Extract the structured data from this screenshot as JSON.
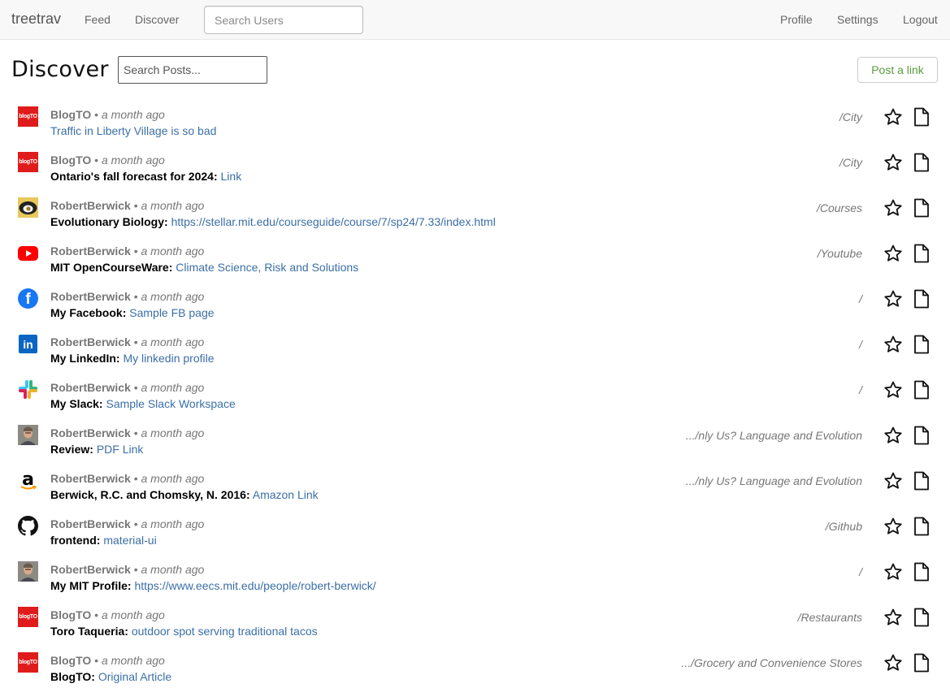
{
  "navbar": {
    "brand": "treetrav",
    "links": {
      "feed": "Feed",
      "discover": "Discover"
    },
    "search_placeholder": "Search Users",
    "right": {
      "profile": "Profile",
      "settings": "Settings",
      "logout": "Logout"
    }
  },
  "page": {
    "title": "Discover",
    "search_placeholder": "Search Posts...",
    "post_button": "Post a link"
  },
  "posts": [
    {
      "icon": "blogto-icon",
      "author": "BlogTO",
      "time": "a month ago",
      "label": "",
      "link": "Traffic in Liberty Village is so bad",
      "path": "/City"
    },
    {
      "icon": "blogto-icon",
      "author": "BlogTO",
      "time": "a month ago",
      "label": "Ontario's fall forecast for 2024:",
      "link": "Link",
      "path": "/City"
    },
    {
      "icon": "mit-courses-icon",
      "author": "RobertBerwick",
      "time": "a month ago",
      "label": "Evolutionary Biology:",
      "link": "https://stellar.mit.edu/courseguide/course/7/sp24/7.33/index.html",
      "path": "/Courses"
    },
    {
      "icon": "youtube-icon",
      "author": "RobertBerwick",
      "time": "a month ago",
      "label": "MIT OpenCourseWare:",
      "link": "Climate Science, Risk and Solutions",
      "path": "/Youtube"
    },
    {
      "icon": "facebook-icon",
      "author": "RobertBerwick",
      "time": "a month ago",
      "label": "My Facebook:",
      "link": "Sample FB page",
      "path": "/"
    },
    {
      "icon": "linkedin-icon",
      "author": "RobertBerwick",
      "time": "a month ago",
      "label": "My LinkedIn:",
      "link": "My linkedin profile",
      "path": "/"
    },
    {
      "icon": "slack-icon",
      "author": "RobertBerwick",
      "time": "a month ago",
      "label": "My Slack:",
      "link": "Sample Slack Workspace",
      "path": "/"
    },
    {
      "icon": "person-photo-icon",
      "author": "RobertBerwick",
      "time": "a month ago",
      "label": "Review:",
      "link": "PDF Link",
      "path": ".../nly Us? Language and Evolution"
    },
    {
      "icon": "amazon-icon",
      "author": "RobertBerwick",
      "time": "a month ago",
      "label": "Berwick, R.C. and Chomsky, N. 2016:",
      "link": "Amazon Link",
      "path": ".../nly Us? Language and Evolution"
    },
    {
      "icon": "github-icon",
      "author": "RobertBerwick",
      "time": "a month ago",
      "label": "frontend:",
      "link": "material-ui",
      "path": "/Github"
    },
    {
      "icon": "person-photo-icon",
      "author": "RobertBerwick",
      "time": "a month ago",
      "label": "My MIT Profile:",
      "link": "https://www.eecs.mit.edu/people/robert-berwick/",
      "path": "/"
    },
    {
      "icon": "blogto-icon",
      "author": "BlogTO",
      "time": "a month ago",
      "label": "Toro Taqueria:",
      "link": "outdoor spot serving traditional tacos",
      "path": "/Restaurants"
    },
    {
      "icon": "blogto-icon",
      "author": "BlogTO",
      "time": "a month ago",
      "label": "BlogTO:",
      "link": "Original Article",
      "path": ".../Grocery and Convenience Stores"
    }
  ],
  "icon_text": {
    "blogto": "blogTO",
    "facebook": "f",
    "linkedin": "in",
    "amazon": "a"
  },
  "colors": {
    "link": "#3b6fa6",
    "post_button": "#5a9a3c",
    "blogto": "#e01b1b",
    "youtube": "#ff0000",
    "facebook": "#1877f2",
    "linkedin": "#0a66c2"
  }
}
